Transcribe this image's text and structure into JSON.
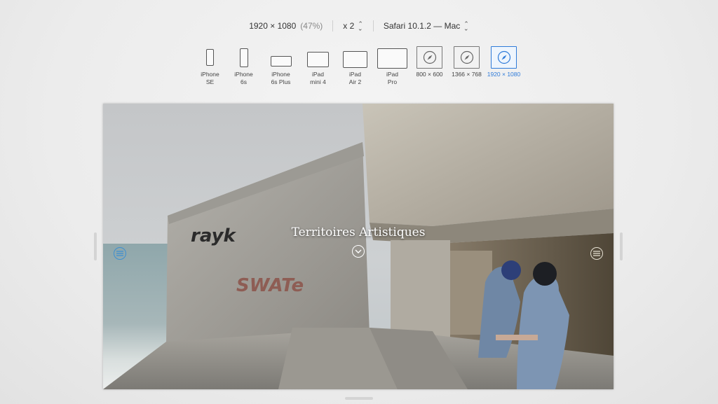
{
  "toolbar": {
    "resolution": "1920 × 1080",
    "percent": "(47%)",
    "scale": "x 2",
    "browser": "Safari 10.1.2 — Mac"
  },
  "devices": [
    {
      "label": "iPhone\nSE",
      "icon": "iphone-se-icon",
      "active": false
    },
    {
      "label": "iPhone\n6s",
      "icon": "iphone-6s-icon",
      "active": false
    },
    {
      "label": "iPhone\n6s Plus",
      "icon": "iphone-6s-plus-icon",
      "active": false
    },
    {
      "label": "iPad\nmini 4",
      "icon": "ipad-mini-icon",
      "active": false
    },
    {
      "label": "iPad\nAir 2",
      "icon": "ipad-air-icon",
      "active": false
    },
    {
      "label": "iPad\nPro",
      "icon": "ipad-pro-icon",
      "active": false
    },
    {
      "label": "800 × 600",
      "icon": "safari-compass-icon",
      "active": false
    },
    {
      "label": "1366 × 768",
      "icon": "safari-compass-icon",
      "active": false
    },
    {
      "label": "1920 × 1080",
      "icon": "safari-compass-icon",
      "active": true
    }
  ],
  "page": {
    "title": "Territoires Artistiques"
  },
  "colors": {
    "accent": "#2f7bd9",
    "text": "#333333"
  }
}
